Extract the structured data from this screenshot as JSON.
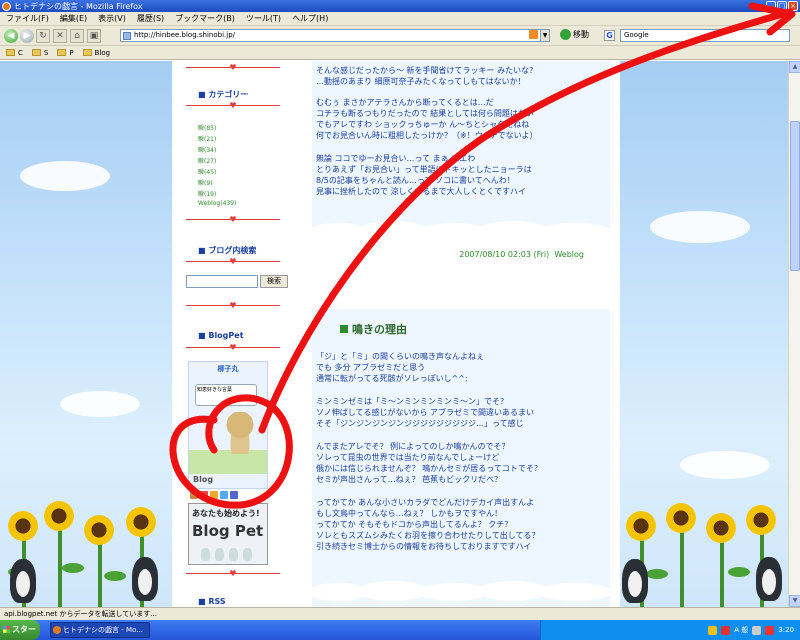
{
  "window": {
    "title": "ヒトデナシの戯言 - Mozilla Firefox",
    "controls": [
      "minimize",
      "maximize",
      "close"
    ]
  },
  "menu": {
    "items": [
      "ファイル(F)",
      "編集(E)",
      "表示(V)",
      "履歴(S)",
      "ブックマーク(B)",
      "ツール(T)",
      "ヘルプ(H)"
    ]
  },
  "nav": {
    "url": "http://hinbee.blog.shinobi.jp/",
    "go_label": "移動",
    "search_value": "Google"
  },
  "bookmarks": {
    "items": [
      "C",
      "S",
      "P",
      "Blog"
    ]
  },
  "sidebar": {
    "category_heading": "カテゴリー",
    "categories": [
      "瞬(85)",
      "瞬(21)",
      "瞬(34)",
      "瞬(27)",
      "瞬(45)",
      "瞬(9)",
      "瞬(19)",
      "Weblog(439)"
    ],
    "search_heading": "ブログ内検索",
    "search_button": "検索",
    "blogpet_heading": "BlogPet",
    "blogpet_name": "柳子丸",
    "blogpet_speech": "知恵好きな言葉",
    "blogpet_logo": "Blog",
    "blogpet_banner_line1": "あなたも始めよう!",
    "blogpet_banner_line2": "Blog Pet",
    "rss_heading": "RSS"
  },
  "post1": {
    "lines": [
      "そんな感じだったから～ 新を手間省けてラッキー みたいな？",
      "…動揺のあまり 細原可奈子みたくなってしもてはないか！",
      "",
      "むむぅ まさかアテラさんから断ってくるとは…だ",
      "コチラも断るつもりだったので 結果としては何ら問題はない",
      "でもアレですわ ショックっちゅーか ん～ちとシャクだねね",
      "何でお見合いん時に粗相したっけか？（※！ウ○チでないよ）",
      "",
      "無論 ココでゆーお見合い…って まぁ エエわ",
      "とりあえず「お見合い」って単語にドキッとしたニョーラは",
      "8/5の記事をちゃんと読ん…って ソコに書いてへんわ！",
      "見事に挫析したので 涼しくなるまで大人しくとくですハイ"
    ],
    "meta": "2007/08/10 02:03 (Fri)",
    "meta_link": "Weblog"
  },
  "post2": {
    "title": "鳴きの理由",
    "lines": [
      "「ジ」と「ミ」の間くらいの鳴き声なんよねぇ",
      "でも 多分 アブラゼミだと思う",
      "通常に転がってる死骸がソレっぽいし^^;",
      "",
      "ミンミンゼミは「ミ～ンミンミンミンミ～ン」でそ？",
      "ソノ伸ばしてる感じがないから アブラゼミで間違いあるまい",
      "そそ「ジンジンジンジンジジジジジジジジジ…」って感じ",
      "",
      "んでまたアレでそ？ 例によってのしか鳴かんのでそ？",
      "ソレって昆虫の世界では当たり前なんでしょーけど",
      "俄かには信じられませんぞ？ 鳴かんセミが居るってコトでそ？",
      "セミが声出さんって…ねぇ？ 芭蕉もビックリだべ？",
      "",
      "ってかてか あんな小さいカラダでどんだけデカイ声出すんよ",
      "もし文鳥中ってんなら…ねぇ？ しかもヲですやん！",
      "ってかてか そもそもドコから声出してるんよ？ クチ？",
      "ソレともスズムシみたくお羽を擦り合わせたりして出してる？",
      "引き続きセミ博士からの情報をお待ちしておりますですハイ"
    ]
  },
  "status": {
    "text": "api.blogpet.net からデータを転送しています..."
  },
  "taskbar": {
    "start_label": "スタート",
    "task_label": "ヒトデナシの戯言 - Mo...",
    "tray_text": "A 般",
    "clock": "3:20"
  },
  "colors": {
    "link_text": "#1a3fa0",
    "green_text": "#2e8a2e",
    "annotation_red": "#ee1111",
    "sky": "#a5cdf3"
  }
}
